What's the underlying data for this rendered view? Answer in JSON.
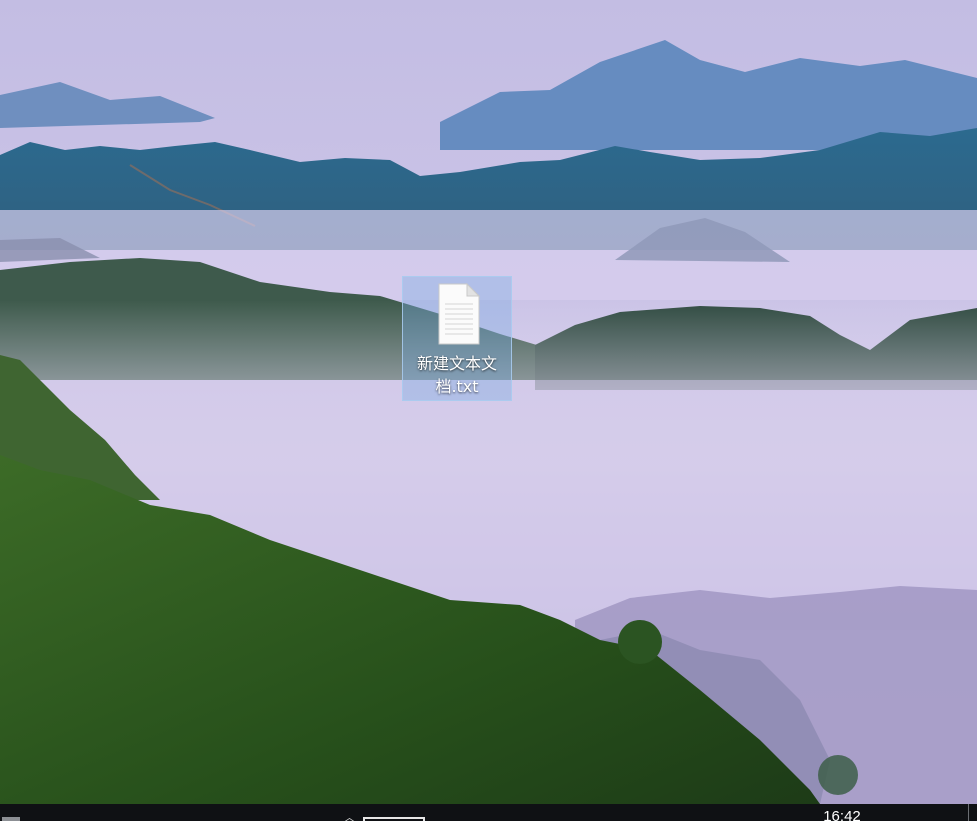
{
  "desktop": {
    "icons": [
      {
        "label": "新建文本文档.txt",
        "icon": "text-file-icon"
      }
    ]
  },
  "taskbar": {
    "clock": "16:42",
    "tray_icons": [
      "chevron-up-icon",
      "window-icon"
    ]
  },
  "colors": {
    "sky": "#c6c0e6",
    "mountains": "#2f5f86",
    "fog": "#d6cdea",
    "forest": "#2f5a1e",
    "selection": "#78aae1",
    "taskbar": "#0f1114"
  }
}
